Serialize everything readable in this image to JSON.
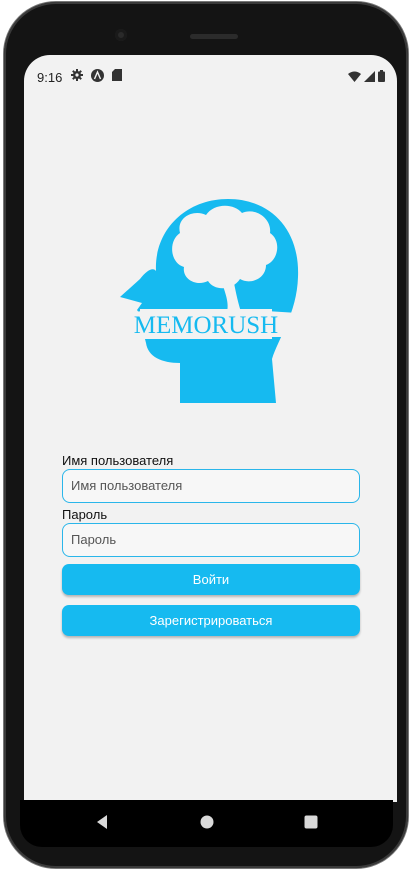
{
  "status_bar": {
    "time": "9:16"
  },
  "login": {
    "logo_text": "MEMORUSH",
    "username_label": "Имя пользователя",
    "username_placeholder": "Имя пользователя",
    "password_label": "Пароль",
    "password_placeholder": "Пароль",
    "login_button": "Войти",
    "register_button": "Зарегистрироваться"
  },
  "colors": {
    "brand": "#16BAF0",
    "screen_bg": "#F2F2F2",
    "field_border": "#2AB6EA"
  },
  "icons": {
    "status_left": [
      "settings-icon",
      "a-circle-icon",
      "sd-card-icon"
    ],
    "status_right": [
      "wifi-icon",
      "signal-icon",
      "battery-icon"
    ],
    "nav": [
      "back-icon",
      "home-icon",
      "recents-icon"
    ]
  }
}
